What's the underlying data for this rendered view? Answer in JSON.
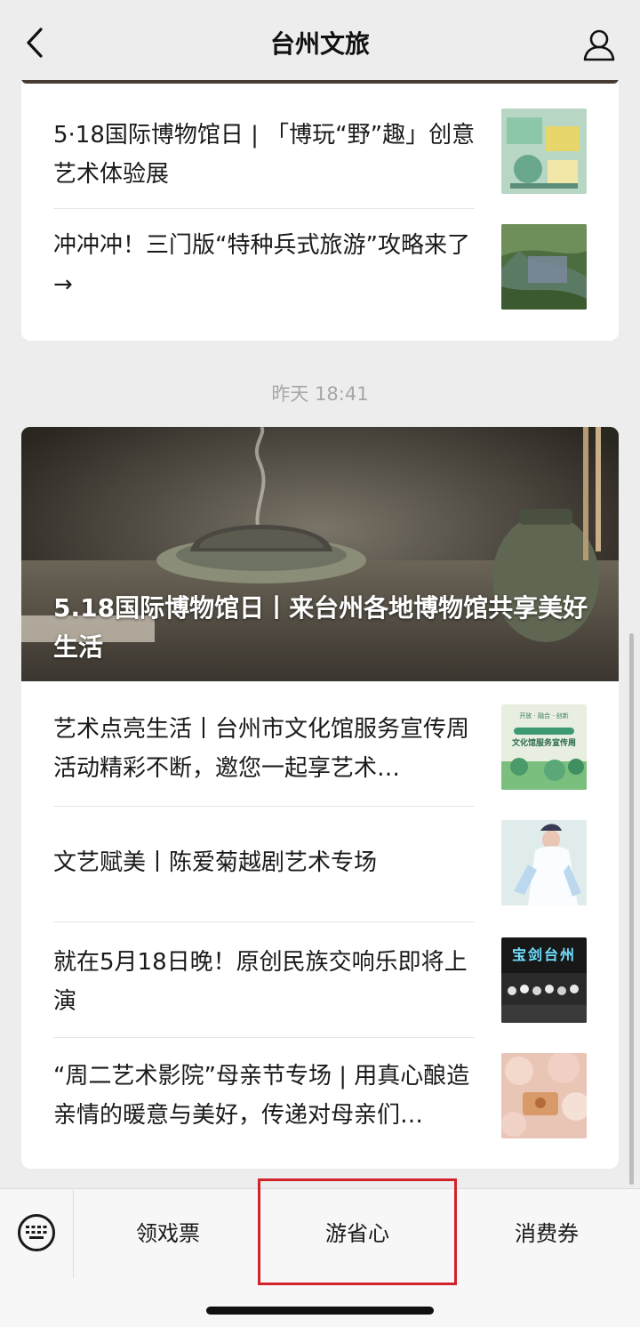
{
  "nav": {
    "title": "台州文旅",
    "back_icon": "chevron-left-icon",
    "profile_icon": "user-icon"
  },
  "top_card": {
    "items": [
      {
        "title": "5·18国际博物馆日 | 「博玩“野”趣」创意艺术体验展"
      },
      {
        "title": "冲冲冲！三门版“特种兵式旅游”攻略来了 →"
      }
    ]
  },
  "timestamp": "昨天 18:41",
  "main_card": {
    "hero_title": "5.18国际博物馆日丨来台州各地博物馆共享美好生活",
    "items": [
      {
        "title": "艺术点亮生活丨台州市文化馆服务宣传周活动精彩不断，邀您一起享艺术…",
        "thumb_text_1": "开放 · 融合 · 创新",
        "thumb_text_2": "文化馆服务宣传周"
      },
      {
        "title": "文艺赋美丨陈爱菊越剧艺术专场"
      },
      {
        "title": "就在5月18日晚！原创民族交响乐即将上演",
        "thumb_text": "宝剑台州"
      },
      {
        "title": "“周二艺术影院”母亲节专场 | 用真心酿造亲情的暖意与美好，传递对母亲们…"
      }
    ]
  },
  "bottom_menu": {
    "keyboard_icon": "keyboard-icon",
    "items": [
      {
        "label": "领戏票"
      },
      {
        "label": "游省心"
      },
      {
        "label": "消费券"
      }
    ],
    "highlight_color": "#d2232a"
  }
}
